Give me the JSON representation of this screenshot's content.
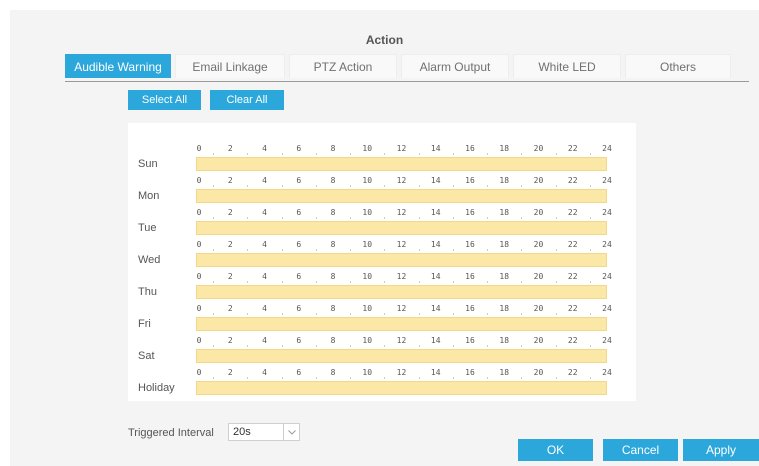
{
  "title": "Action",
  "tabs": [
    {
      "label": "Audible Warning",
      "active": true
    },
    {
      "label": "Email Linkage",
      "active": false
    },
    {
      "label": "PTZ Action",
      "active": false
    },
    {
      "label": "Alarm Output",
      "active": false
    },
    {
      "label": "White LED",
      "active": false
    },
    {
      "label": "Others",
      "active": false
    }
  ],
  "toolbar": {
    "select_all": "Select All",
    "clear_all": "Clear All"
  },
  "schedule": {
    "hour_ticks": [
      "0",
      "2",
      "4",
      "6",
      "8",
      "10",
      "12",
      "14",
      "16",
      "18",
      "20",
      "22",
      "24"
    ],
    "days": [
      "Sun",
      "Mon",
      "Tue",
      "Wed",
      "Thu",
      "Fri",
      "Sat",
      "Holiday"
    ],
    "bar_color": "#fbe8a6"
  },
  "interval": {
    "label": "Triggered Interval",
    "value": "20s"
  },
  "footer": {
    "ok": "OK",
    "cancel": "Cancel",
    "apply": "Apply"
  },
  "colors": {
    "accent": "#2ba7db"
  },
  "icons": {
    "select_arrow": "chevron-down-icon"
  }
}
